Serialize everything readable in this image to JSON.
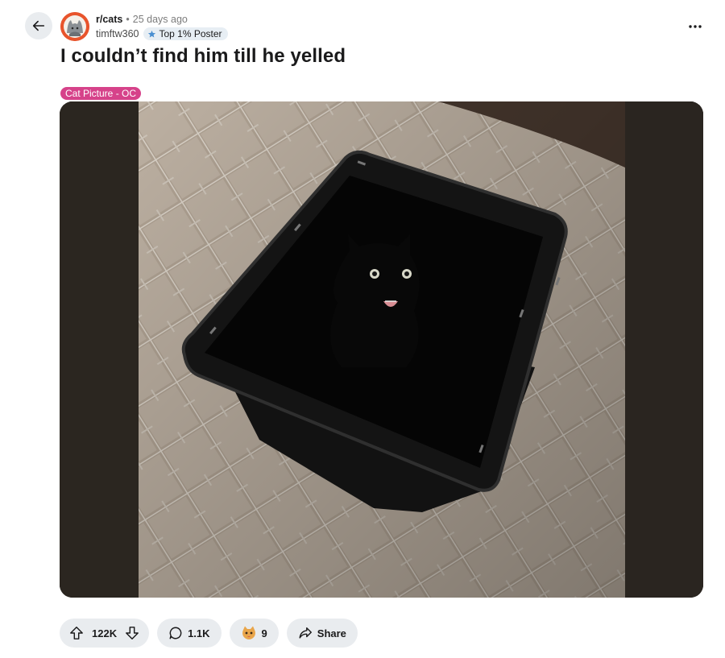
{
  "post": {
    "subreddit": "r/cats",
    "separator": "•",
    "age": "25 days ago",
    "author": "timftw360",
    "author_badge": "Top 1% Poster",
    "title": "I couldn’t find him till he yelled",
    "flair": "Cat Picture - OC"
  },
  "actions": {
    "upvotes": "122K",
    "comments": "1.1K",
    "awards": "9",
    "share_label": "Share"
  },
  "icons": {
    "back": "arrow-left-icon",
    "more": "more-horizontal-icon",
    "upvote": "arrow-up-icon",
    "downvote": "arrow-down-icon",
    "comment": "speech-bubble-icon",
    "award": "cat-award-icon",
    "share": "share-arrow-icon",
    "badge": "top-poster-icon"
  },
  "colors": {
    "flair_bg": "#d6428a",
    "pill_bg": "#e9ecef",
    "badge_bg": "#e7eef4"
  }
}
